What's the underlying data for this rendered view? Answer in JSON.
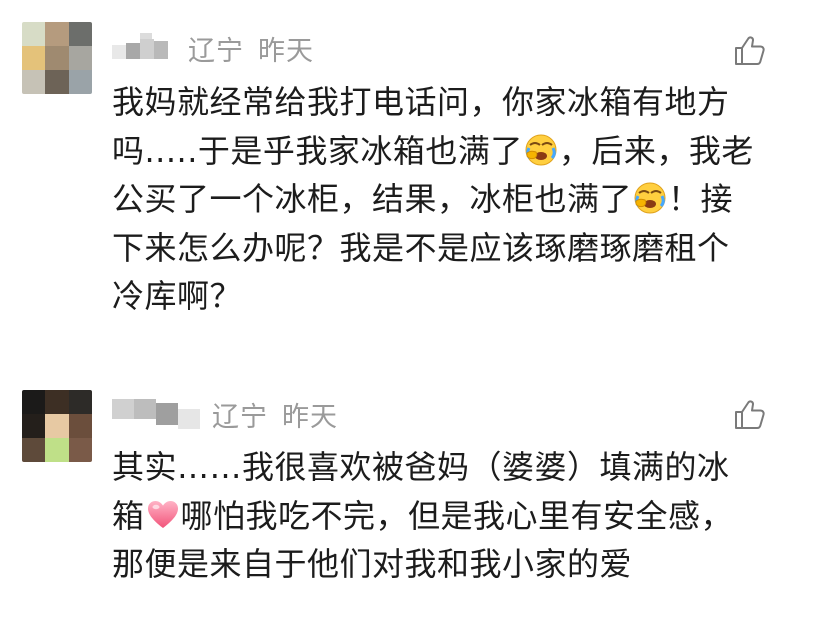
{
  "comments": [
    {
      "location": "辽宁",
      "time": "昨天",
      "avatar_colors": [
        "#d7dcc6",
        "#b59b7e",
        "#6c6e6b",
        "#e4c27a",
        "#9f8a70",
        "#a7a6a0",
        "#c6c2b6",
        "#6d6357",
        "#9aa3a8"
      ],
      "body_lines": [
        [
          "我妈就经常给我打电话问，你家冰箱有地方"
        ],
        [
          "吗.....于是乎我家冰箱也满了",
          "{emoji}",
          "，后来，我老"
        ],
        [
          "公买了一个冰柜，结果，冰柜也满了",
          "{emoji}",
          "！接"
        ],
        [
          "下来怎么办呢？我是不是应该琢磨琢磨租个"
        ],
        [
          "冷库啊？"
        ]
      ],
      "emojis": [
        "facepalm-cry-emoji",
        "facepalm-cry-emoji"
      ]
    },
    {
      "location": "辽宁",
      "time": "昨天",
      "avatar_colors": [
        "#1b1a19",
        "#3d2f24",
        "#2d2b28",
        "#241f1b",
        "#e7c9a3",
        "#6b4e3c",
        "#5e4a3a",
        "#bfe088",
        "#7a5a48"
      ],
      "body_lines": [
        [
          "其实……我很喜欢被爸妈（婆婆）填满的冰"
        ],
        [
          "箱",
          "{emoji}",
          "哪怕我吃不完，但是我心里有安全感，"
        ],
        [
          "那便是来自于他们对我和我小家的爱"
        ]
      ],
      "emojis": [
        "pink-heart-emoji"
      ]
    }
  ],
  "colors": {
    "meta_text": "#9a9a9a",
    "body_text": "#1c1c1c",
    "like_icon": "#7a7a7a"
  }
}
